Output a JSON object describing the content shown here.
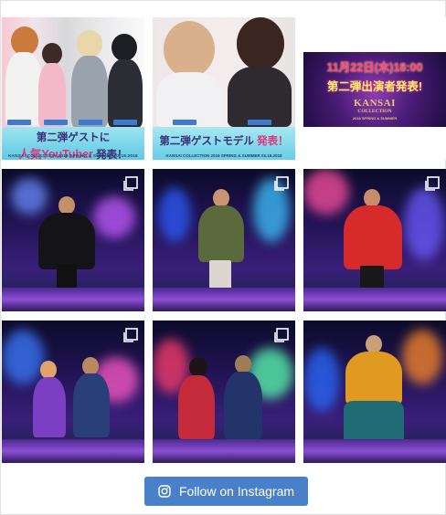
{
  "feed": {
    "posts": [
      {
        "type": "announcement-youtuber",
        "banner_prefix": "第二弾ゲスト",
        "banner_mid": "に",
        "banner_highlight": "人気YouTuber",
        "banner_suffix": " 発表！",
        "banner_sub": "KANSAI COLLECTION 2018 SPRING & SUMMER 03.19.2018"
      },
      {
        "type": "announcement-model",
        "banner_prefix": "第二弾ゲストモデル",
        "banner_suffix": " 発表！",
        "banner_sub": "KANSAI COLLECTION 2018 SPRING & SUMMER 03.19.2018"
      },
      {
        "type": "announcement-date",
        "date": "11月22日(木)18:00",
        "headline": "第二弾出演者発表!",
        "logo": "KANSAI",
        "logo2": "COLLECTION",
        "season": "2018 SPRING & SUMMER"
      },
      {
        "type": "runway",
        "multi": true
      },
      {
        "type": "runway",
        "multi": true
      },
      {
        "type": "runway",
        "multi": true
      },
      {
        "type": "runway",
        "multi": true
      },
      {
        "type": "runway",
        "multi": true
      },
      {
        "type": "runway",
        "multi": false
      }
    ]
  },
  "follow_button": {
    "label": "Follow on Instagram",
    "icon": "instagram-icon",
    "color": "#4a80c8"
  }
}
